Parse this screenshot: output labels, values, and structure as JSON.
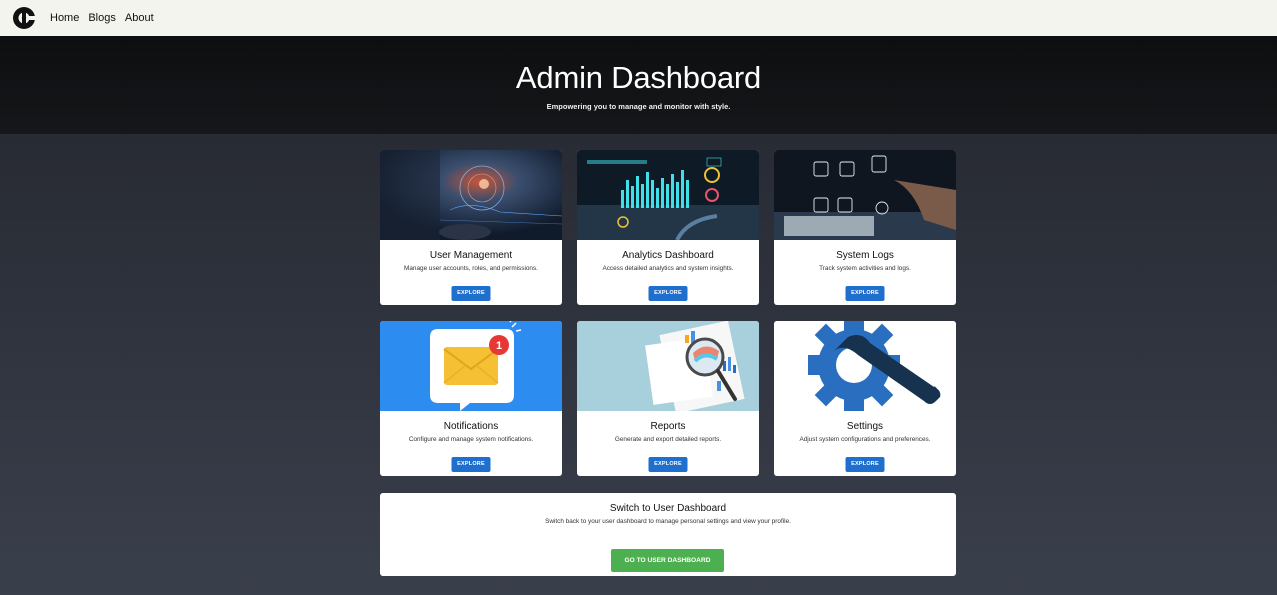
{
  "nav": {
    "home": "Home",
    "blogs": "Blogs",
    "about": "About"
  },
  "hero": {
    "title": "Admin Dashboard",
    "subtitle": "Empowering you to manage and monitor with style."
  },
  "cards": [
    {
      "title": "User Management",
      "desc": "Manage user accounts, roles, and permissions.",
      "button": "EXPLORE"
    },
    {
      "title": "Analytics Dashboard",
      "desc": "Access detailed analytics and system insights.",
      "button": "EXPLORE"
    },
    {
      "title": "System Logs",
      "desc": "Track system activities and logs.",
      "button": "EXPLORE"
    },
    {
      "title": "Notifications",
      "desc": "Configure and manage system notifications.",
      "button": "EXPLORE",
      "badge": "1"
    },
    {
      "title": "Reports",
      "desc": "Generate and export detailed reports.",
      "button": "EXPLORE"
    },
    {
      "title": "Settings",
      "desc": "Adjust system configurations and preferences.",
      "button": "EXPLORE"
    }
  ],
  "switch": {
    "title": "Switch to User Dashboard",
    "desc": "Switch back to your user dashboard to manage personal settings and view your profile.",
    "button": "GO TO USER DASHBOARD"
  },
  "colors": {
    "primary": "#1e6fce",
    "success": "#4caf50",
    "notify_blue": "#2c8cf0"
  }
}
